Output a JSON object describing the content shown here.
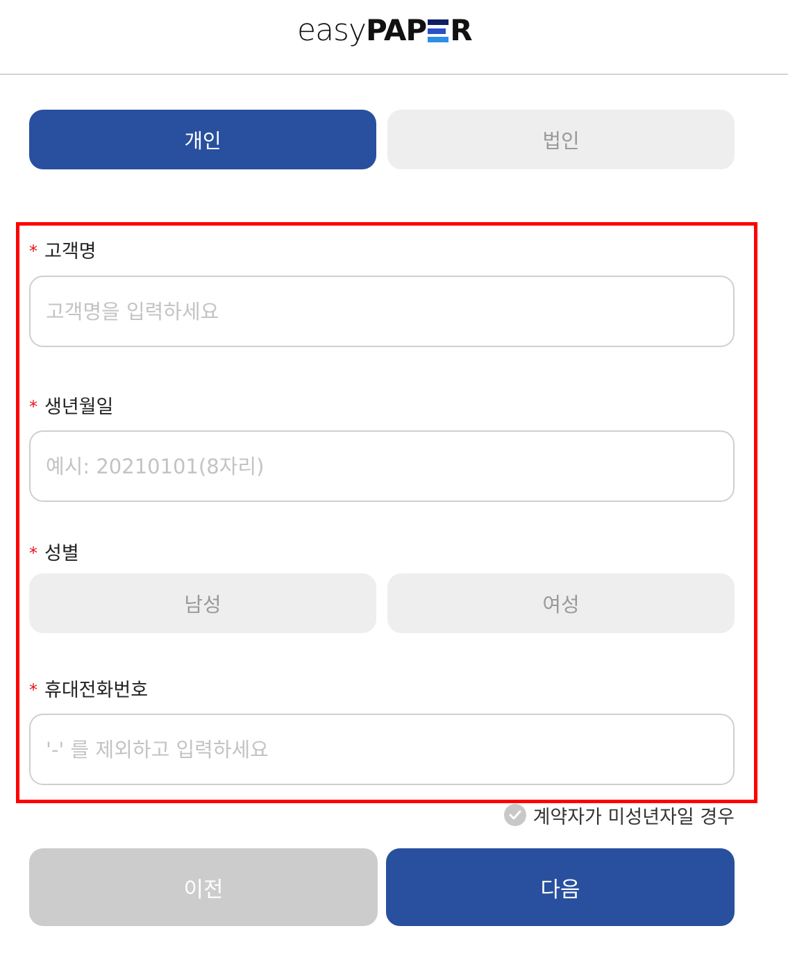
{
  "header": {
    "logo_light": "easy",
    "logo_bold_left": "PAP",
    "logo_bold_right": "R"
  },
  "customer_type": {
    "individual": "개인",
    "corporate": "법인",
    "selected": "개인"
  },
  "form": {
    "name": {
      "label": "고객명",
      "placeholder": "고객명을 입력하세요",
      "value": ""
    },
    "birth": {
      "label": "생년월일",
      "placeholder": "예시: 20210101(8자리)",
      "value": ""
    },
    "gender": {
      "label": "성별",
      "male": "남성",
      "female": "여성"
    },
    "phone": {
      "label": "휴대전화번호",
      "placeholder": "'-' 를 제외하고 입력하세요",
      "value": ""
    },
    "required_mark": "*"
  },
  "minor_check": {
    "label": "계약자가 미성년자일 경우",
    "checked": false
  },
  "nav": {
    "prev": "이전",
    "next": "다음"
  },
  "colors": {
    "primary": "#29509e",
    "required": "#e8141c",
    "highlight": "#ff0000"
  }
}
